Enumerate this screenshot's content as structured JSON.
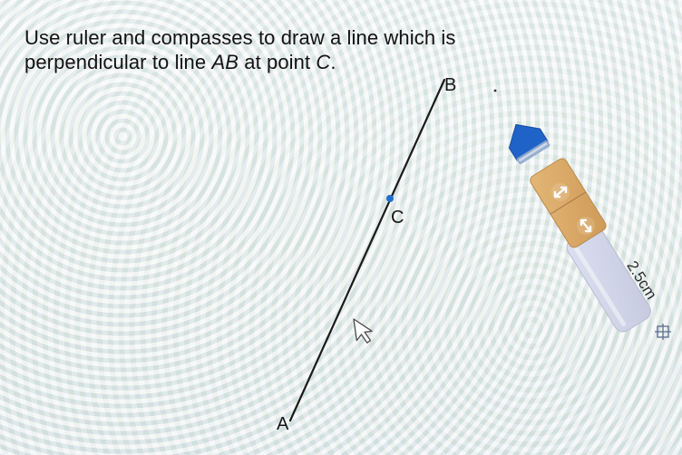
{
  "question": {
    "line1": "Use ruler and compasses to draw a line which is",
    "line2_prefix": "perpendicular to line ",
    "line2_segment": "AB",
    "line2_middle": " at point ",
    "line2_point": "C",
    "line2_suffix": "."
  },
  "points": {
    "a_label": "A",
    "b_label": "B",
    "c_label": "C"
  },
  "compass_tool": {
    "radius_text": "2.5cm"
  },
  "colors": {
    "line": "#1a1a1a",
    "point_c": "#1f6fd1",
    "pencil_tip": "#1f63c9",
    "arm_top": "#d9a866",
    "arm_bottom": "#cfd3e4"
  }
}
